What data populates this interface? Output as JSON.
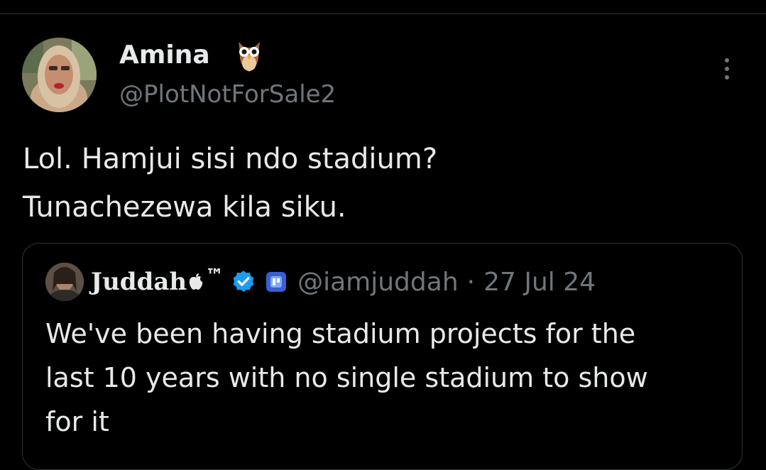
{
  "author": {
    "name": "Amina",
    "handle": "@PlotNotForSale2",
    "badge_emoji": "owl-emoji",
    "avatar": "avatar-photo"
  },
  "more_menu_icon": "more-vertical-icon",
  "tweet": {
    "lines": [
      "Lol. Hamjui sisi ndo stadium?",
      "Tunachezewa kila siku."
    ]
  },
  "quoted_tweet": {
    "name": "Juddah",
    "name_suffix": "™",
    "apple_icon": "apple-logo-icon",
    "verified_icon": "verified-badge-icon",
    "affiliate_icon": "affiliate-badge-icon",
    "handle": "@iamjuddah",
    "separator": "·",
    "date": "27 Jul 24",
    "lines": [
      "We've been having stadium projects for the",
      "last 10 years with no single stadium to show",
      "for it"
    ]
  },
  "colors": {
    "background": "#000000",
    "text_primary": "#e7e9ea",
    "text_secondary": "#71767b",
    "border": "#2f3336",
    "verified": "#1d9bf0"
  }
}
